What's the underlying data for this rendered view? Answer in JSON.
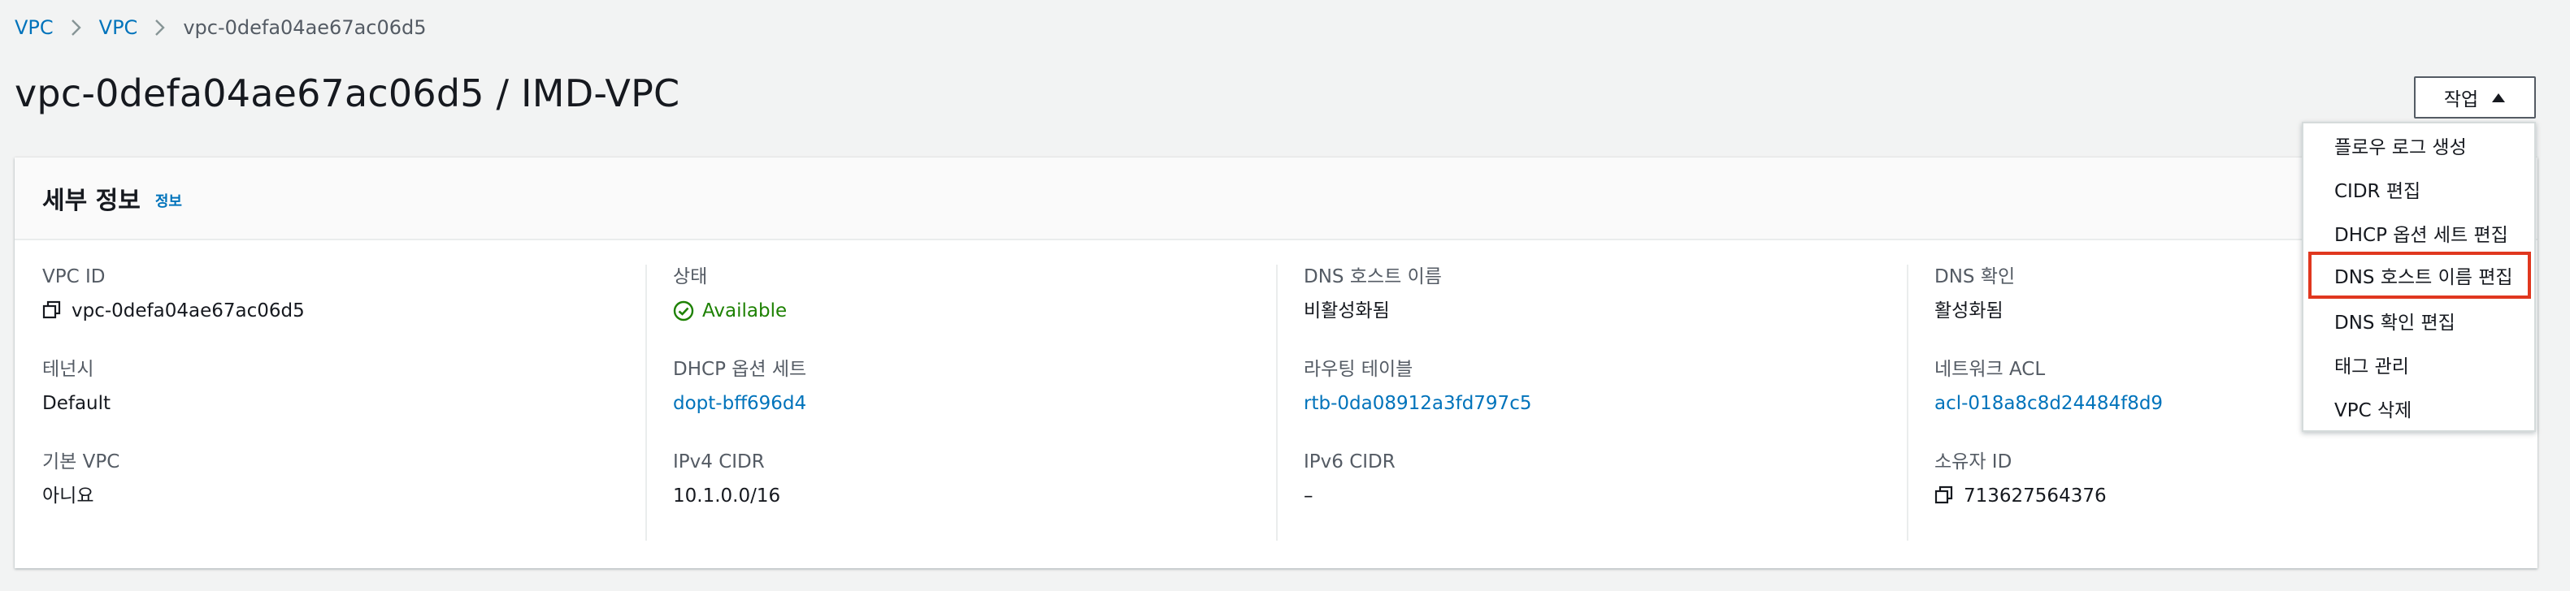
{
  "breadcrumb": {
    "items": [
      "VPC",
      "VPC",
      "vpc-0defa04ae67ac06d5"
    ]
  },
  "page": {
    "title": "vpc-0defa04ae67ac06d5 / IMD-VPC"
  },
  "actions": {
    "label": "작업",
    "menu": [
      "플로우 로그 생성",
      "CIDR 편집",
      "DHCP 옵션 세트 편집",
      "DNS 호스트 이름 편집",
      "DNS 확인 편집",
      "태그 관리",
      "VPC 삭제"
    ],
    "highlighted_item": "DNS 호스트 이름 편집"
  },
  "details": {
    "title": "세부 정보",
    "info_link": "정보",
    "columns": [
      {
        "fields": [
          {
            "label": "VPC ID",
            "value": "vpc-0defa04ae67ac06d5"
          },
          {
            "label": "테넌시",
            "value": "Default"
          },
          {
            "label": "기본 VPC",
            "value": "아니요"
          }
        ]
      },
      {
        "fields": [
          {
            "label": "상태",
            "value": "Available"
          },
          {
            "label": "DHCP 옵션 세트",
            "value": "dopt-bff696d4"
          },
          {
            "label": "IPv4 CIDR",
            "value": "10.1.0.0/16"
          }
        ]
      },
      {
        "fields": [
          {
            "label": "DNS 호스트 이름",
            "value": "비활성화됨"
          },
          {
            "label": "라우팅 테이블",
            "value": "rtb-0da08912a3fd797c5"
          },
          {
            "label": "IPv6 CIDR",
            "value": "–"
          }
        ]
      },
      {
        "fields": [
          {
            "label": "DNS 확인",
            "value": "활성화됨"
          },
          {
            "label": "네트워크 ACL",
            "value": "acl-018a8c8d24484f8d9"
          },
          {
            "label": "소유자 ID",
            "value": "713627564376"
          }
        ]
      }
    ]
  },
  "colors": {
    "link": "#0073bb",
    "status_ok": "#1d8102",
    "highlight_border": "#e0371f",
    "background": "#f2f3f3"
  },
  "icons": [
    "chevron-right-icon",
    "caret-up-icon",
    "copy-icon",
    "check-circle-icon"
  ]
}
